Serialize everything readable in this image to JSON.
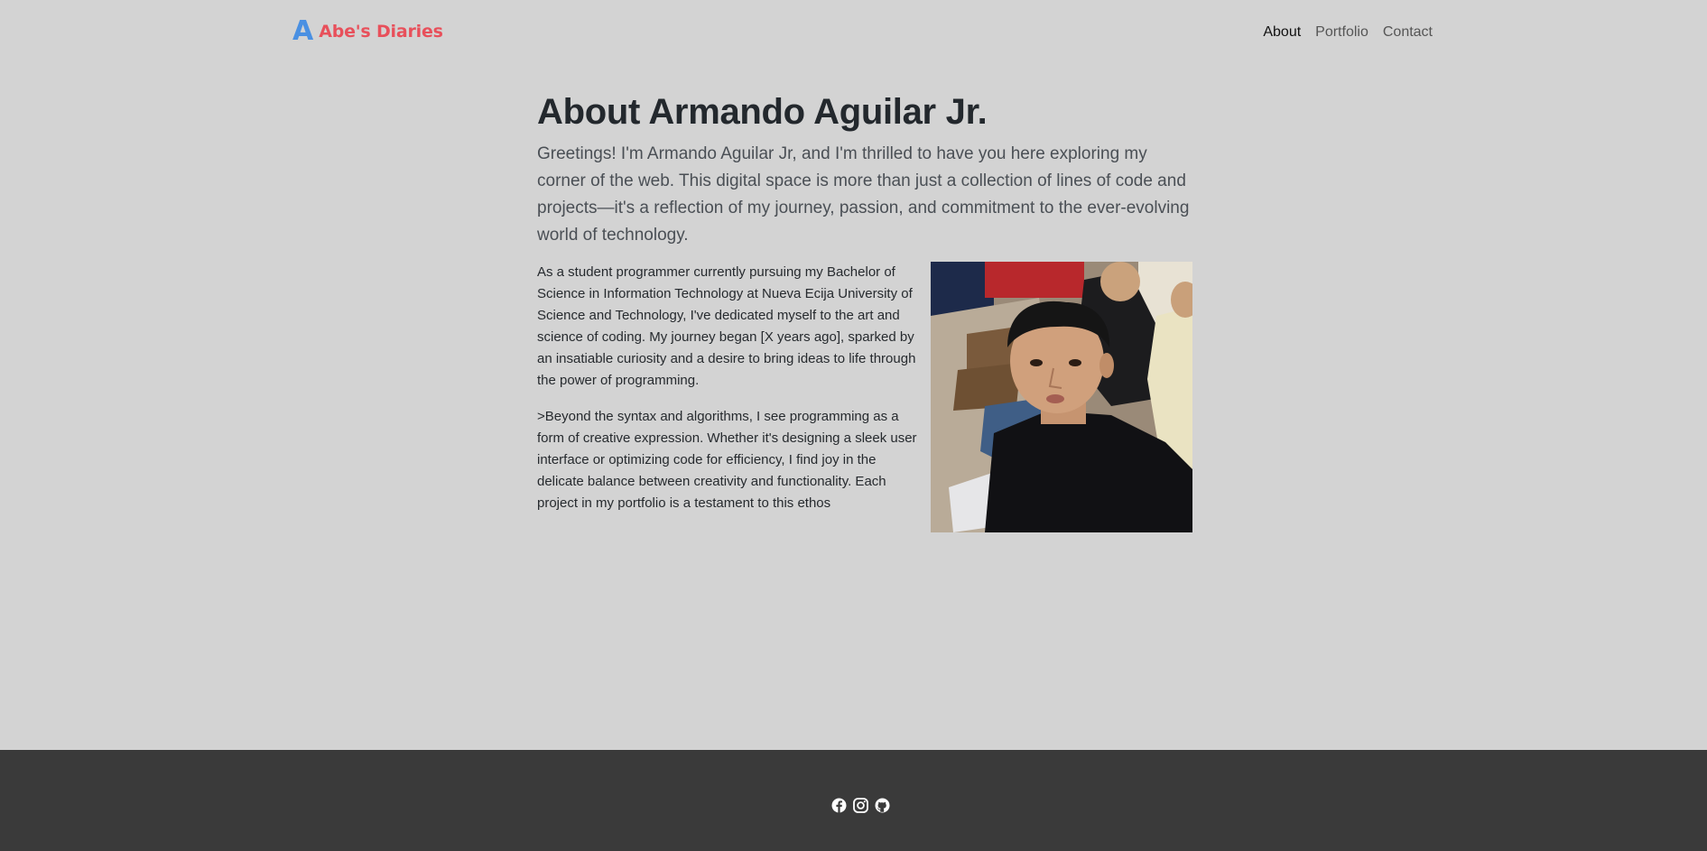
{
  "brand": {
    "logo_letter": "A",
    "name": "Abe's Diaries"
  },
  "nav": {
    "items": [
      "About",
      "Portfolio",
      "Contact"
    ],
    "active": "About"
  },
  "main": {
    "title": "About Armando Aguilar Jr.",
    "lead": "Greetings! I'm Armando Aguilar Jr, and I'm thrilled to have you here exploring my corner of the web. This digital space is more than just a collection of lines of code and projects—it's a reflection of my journey, passion, and commitment to the ever-evolving world of technology.",
    "paragraphs": [
      "As a student programmer currently pursuing my Bachelor of Science in Information Technology at Nueva Ecija University of Science and Technology, I've dedicated myself to the art and science of coding. My journey began [X years ago], sparked by an insatiable curiosity and a desire to bring ideas to life through the power of programming.",
      ">Beyond the syntax and algorithms, I see programming as a form of creative expression. Whether it's designing a sleek user interface or optimizing code for efficiency, I find joy in the delicate balance between creativity and functionality. Each project in my portfolio is a testament to this ethos"
    ]
  },
  "footer": {
    "social_icons": [
      "facebook-icon",
      "instagram-icon",
      "github-icon"
    ]
  },
  "colors": {
    "background": "#d3d3d3",
    "brand_blue": "#4a90e2",
    "brand_red": "#e8505b",
    "footer": "#3a3a3a"
  }
}
